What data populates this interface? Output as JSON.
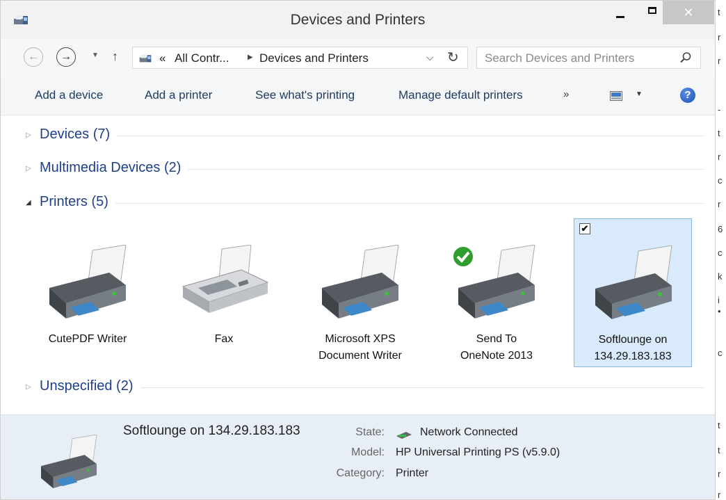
{
  "window": {
    "title": "Devices and Printers",
    "close_glyph": "✕"
  },
  "nav": {
    "back_glyph": "←",
    "forward_glyph": "→",
    "breadcrumb_overflow": "«",
    "breadcrumbs": [
      "All Contr...",
      "Devices and Printers"
    ],
    "search_placeholder": "Search Devices and Printers"
  },
  "toolbar": {
    "add_device": "Add a device",
    "add_printer": "Add a printer",
    "see_printing": "See what's printing",
    "manage_default": "Manage default printers",
    "more": "»",
    "help": "?"
  },
  "groups": {
    "devices": {
      "label": "Devices (7)"
    },
    "multimedia": {
      "label": "Multimedia Devices (2)"
    },
    "printers": {
      "label": "Printers (5)"
    },
    "unspecified": {
      "label": "Unspecified (2)"
    }
  },
  "printers": [
    {
      "line1": "CutePDF Writer",
      "line2": ""
    },
    {
      "line1": "Fax",
      "line2": ""
    },
    {
      "line1": "Microsoft XPS",
      "line2": "Document Writer"
    },
    {
      "line1": "Send To",
      "line2": "OneNote 2013",
      "default": true
    },
    {
      "line1": "Softlounge on",
      "line2": "134.29.183.183",
      "selected": true
    }
  ],
  "details": {
    "name": "Softlounge on 134.29.183.183",
    "state_label": "State:",
    "state_value": "Network Connected",
    "model_label": "Model:",
    "model_value": "HP Universal Printing PS (v5.9.0)",
    "category_label": "Category:",
    "category_value": "Printer"
  },
  "background_fragments": [
    "t",
    "r",
    "r",
    "-",
    "t",
    "r",
    "c",
    "r",
    "6",
    "c",
    "k",
    "i",
    "•",
    "c",
    "t",
    "t",
    "r",
    "r"
  ],
  "colors": {
    "group_title": "#1e3f8c",
    "command_text": "#1e3a5f",
    "selection_bg": "#d8eafc",
    "details_bg": "#e7eef6"
  }
}
